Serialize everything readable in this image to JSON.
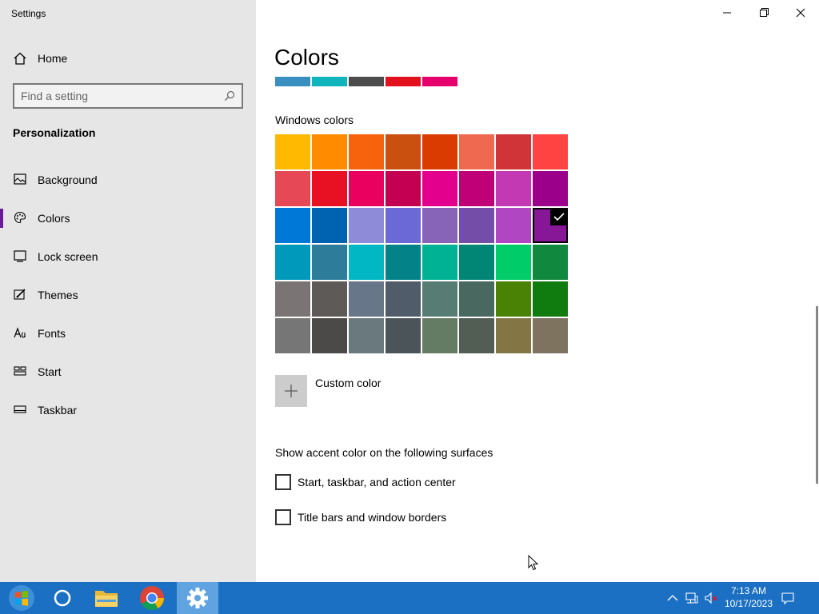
{
  "window": {
    "title": "Settings",
    "controls": [
      "minimize",
      "restore",
      "close"
    ]
  },
  "sidebar": {
    "home_label": "Home",
    "search_placeholder": "Find a setting",
    "section_title": "Personalization",
    "items": [
      {
        "label": "Background",
        "icon": "picture-icon"
      },
      {
        "label": "Colors",
        "icon": "palette-icon",
        "active": true
      },
      {
        "label": "Lock screen",
        "icon": "lock-screen-icon"
      },
      {
        "label": "Themes",
        "icon": "brush-icon"
      },
      {
        "label": "Fonts",
        "icon": "fonts-icon"
      },
      {
        "label": "Start",
        "icon": "start-icon"
      },
      {
        "label": "Taskbar",
        "icon": "taskbar-icon"
      }
    ]
  },
  "main": {
    "title": "Colors",
    "recent_colors": [
      "#3a8fc1",
      "#10b5bb",
      "#4c4c4c",
      "#e3101e",
      "#e6006e"
    ],
    "windows_colors_label": "Windows colors",
    "windows_colors": [
      "#ffb900",
      "#ff8c00",
      "#f7630c",
      "#ca5010",
      "#da3b01",
      "#ef6950",
      "#d13438",
      "#ff4343",
      "#e74856",
      "#e81123",
      "#ea005e",
      "#c30052",
      "#e3008c",
      "#bf0077",
      "#c239b3",
      "#9a0089",
      "#0078d7",
      "#0063b1",
      "#8e8cd8",
      "#6b69d6",
      "#8764b8",
      "#744da9",
      "#b146c2",
      "#881798",
      "#0099bc",
      "#2d7d9a",
      "#00b7c3",
      "#038387",
      "#00b294",
      "#018574",
      "#00cc6a",
      "#10893e",
      "#7a7574",
      "#5d5a58",
      "#68768a",
      "#515c6b",
      "#567c73",
      "#486860",
      "#498205",
      "#107c10",
      "#767676",
      "#4c4a48",
      "#69797e",
      "#4a5459",
      "#647c64",
      "#525e54",
      "#847545",
      "#7e735f"
    ],
    "selected_index": 23,
    "custom_color_label": "Custom color",
    "surfaces_label": "Show accent color on the following surfaces",
    "checkboxes": [
      {
        "label": "Start, taskbar, and action center",
        "checked": false
      },
      {
        "label": "Title bars and window borders",
        "checked": false
      }
    ]
  },
  "taskbar": {
    "apps": [
      "start-button",
      "cortana-icon",
      "file-explorer-icon",
      "chrome-icon",
      "settings-icon"
    ],
    "time": "7:13 AM",
    "date": "10/17/2023"
  }
}
